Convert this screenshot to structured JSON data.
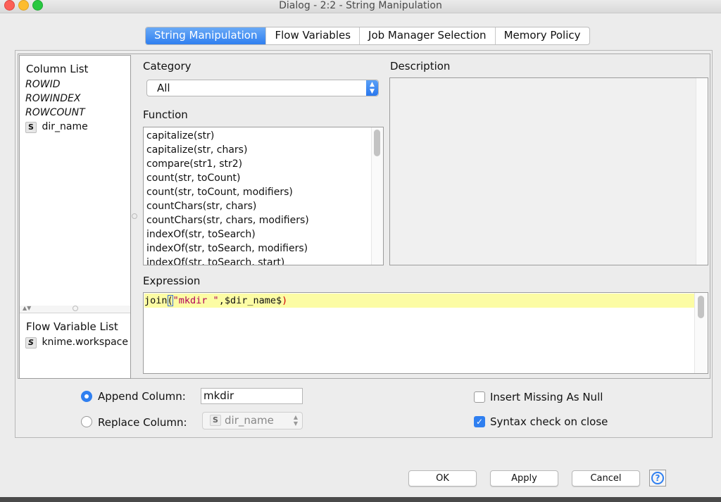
{
  "window": {
    "title": "Dialog - 2:2 - String Manipulation"
  },
  "tabs": [
    {
      "label": "String Manipulation",
      "active": true
    },
    {
      "label": "Flow Variables",
      "active": false
    },
    {
      "label": "Job Manager Selection",
      "active": false
    },
    {
      "label": "Memory Policy",
      "active": false
    }
  ],
  "column_list": {
    "title": "Column List",
    "items": [
      "ROWID",
      "ROWINDEX",
      "ROWCOUNT"
    ],
    "columns": [
      {
        "type_badge": "S",
        "name": "dir_name"
      }
    ]
  },
  "flow_variable_list": {
    "title": "Flow Variable List",
    "items": [
      {
        "type_badge": "S",
        "name": "knime.workspace"
      }
    ]
  },
  "category": {
    "label": "Category",
    "value": "All"
  },
  "function": {
    "label": "Function",
    "items": [
      "capitalize(str)",
      "capitalize(str, chars)",
      "compare(str1, str2)",
      "count(str, toCount)",
      "count(str, toCount, modifiers)",
      "countChars(str, chars)",
      "countChars(str, chars, modifiers)",
      "indexOf(str, toSearch)",
      "indexOf(str, toSearch, modifiers)",
      "indexOf(str, toSearch, start)"
    ]
  },
  "description": {
    "label": "Description"
  },
  "expression": {
    "label": "Expression",
    "tokens": {
      "fn": "join",
      "open": "(",
      "str": "\"mkdir \"",
      "comma": ",",
      "col": "$dir_name$",
      "close": ")"
    }
  },
  "append_column": {
    "label": "Append Column:",
    "value": "mkdir",
    "selected": true
  },
  "replace_column": {
    "label": "Replace Column:",
    "type_badge": "S",
    "value": "dir_name",
    "selected": false
  },
  "insert_missing": {
    "label": "Insert Missing As Null",
    "checked": false
  },
  "syntax_check": {
    "label": "Syntax check on close",
    "checked": true
  },
  "buttons": {
    "ok": "OK",
    "apply": "Apply",
    "cancel": "Cancel",
    "help": "?"
  },
  "colors": {
    "accent": "#2f7ff0",
    "expr_highlight": "#fcfca4",
    "string_literal": "#b0005a",
    "close_paren": "#d00000"
  }
}
